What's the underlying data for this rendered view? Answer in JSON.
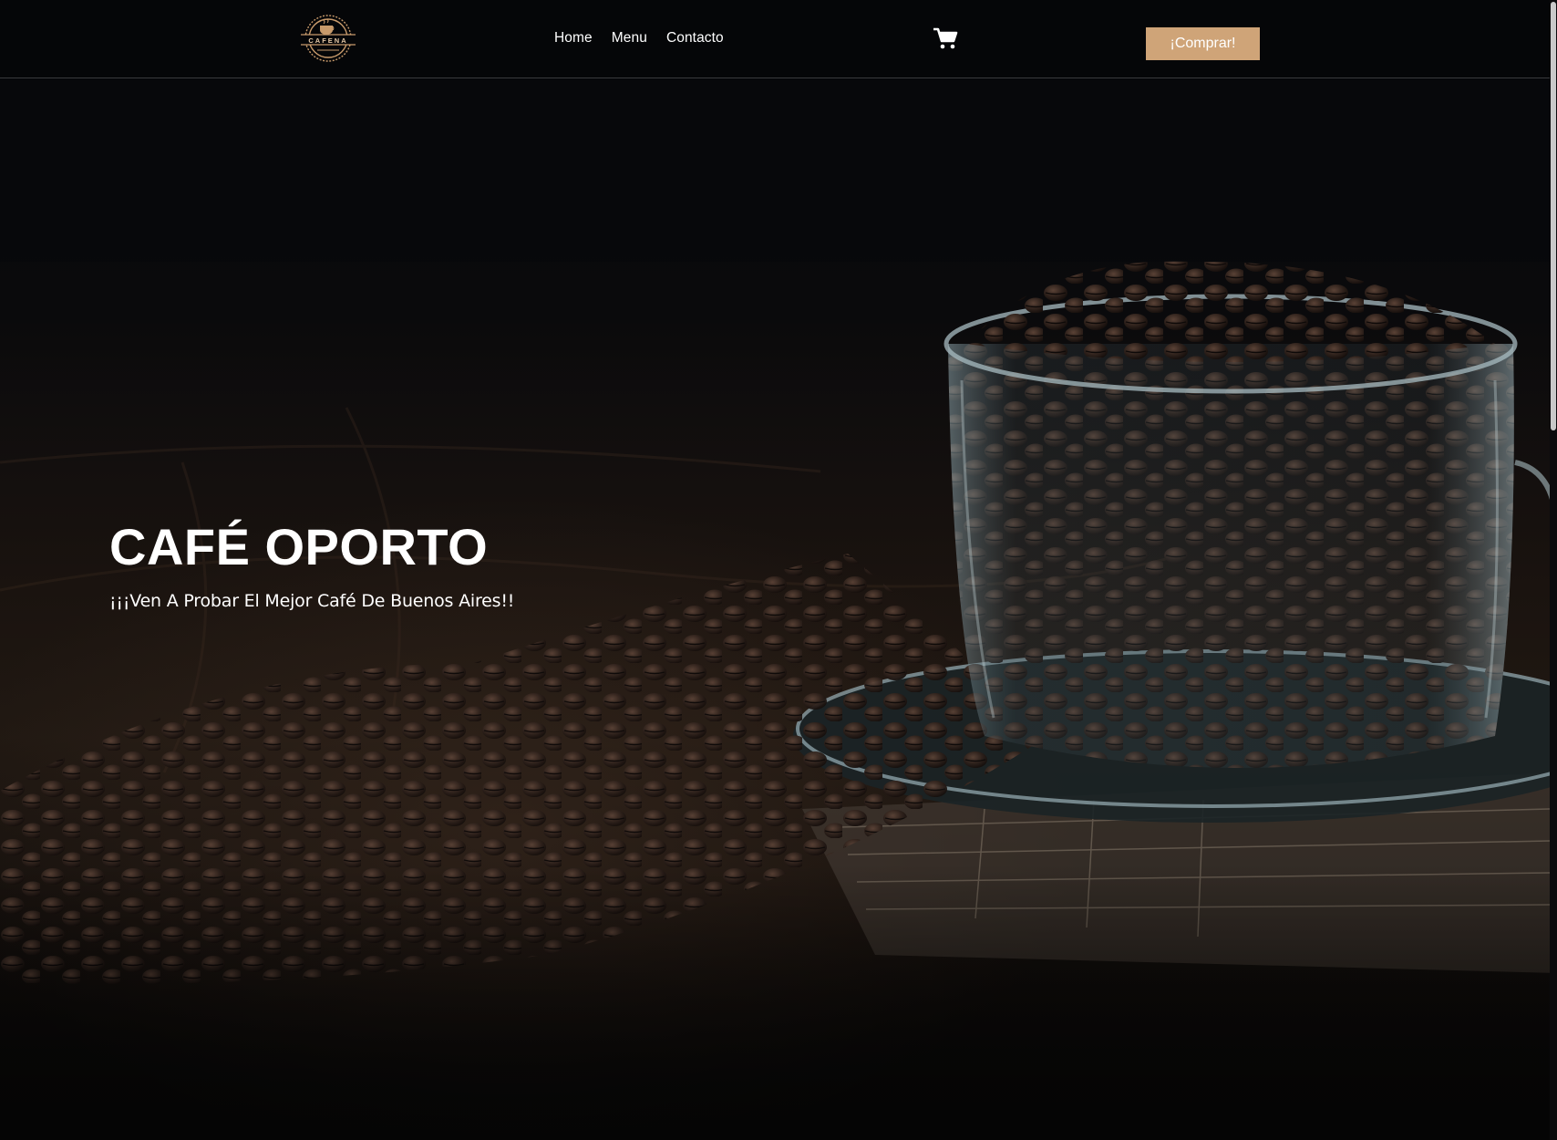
{
  "navbar": {
    "logo_text": "CAFENA",
    "links": [
      {
        "label": "Home"
      },
      {
        "label": "Menu"
      },
      {
        "label": "Contacto"
      }
    ],
    "cart_icon": "shopping-cart-icon",
    "buy_button": "¡Comprar!"
  },
  "hero": {
    "title": "CAFÉ OPORTO",
    "subtitle": "¡¡¡Ven A Probar El Mejor Café De Buenos Aires!!",
    "image": "coffee-beans-in-glass-cup"
  },
  "colors": {
    "background": "#050608",
    "accent": "#cfa478",
    "text": "#ffffff"
  }
}
